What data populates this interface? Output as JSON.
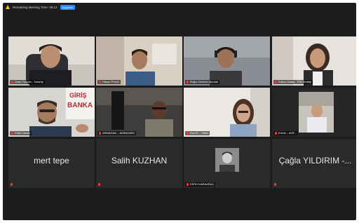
{
  "meeting": {
    "remaining_text": "Remaining Meeting Time: 08:12",
    "upgrade_label": "Upgrade"
  },
  "participants": [
    {
      "name": "Ozan Tuncan - Solarity"
    },
    {
      "name": "Hasan Perçin"
    },
    {
      "name": "Buğra Demirsi @zolak"
    },
    {
      "name": "Kübra Ulutaş - ITM Strateji"
    },
    {
      "name": "Fatih Canan"
    },
    {
      "name": "ARMAGAN – MOBILMED"
    },
    {
      "name": "Ece Er – Ottori"
    },
    {
      "name": "Ermet – AVR..."
    },
    {
      "name": "mert tepe"
    },
    {
      "name": "Salih KUZHAN"
    },
    {
      "name": "FATIH KARAAĞAÇ"
    },
    {
      "name": "Çağla YILDIRIM -..."
    }
  ],
  "signage": {
    "text": "GİRİŞ BANKA"
  }
}
